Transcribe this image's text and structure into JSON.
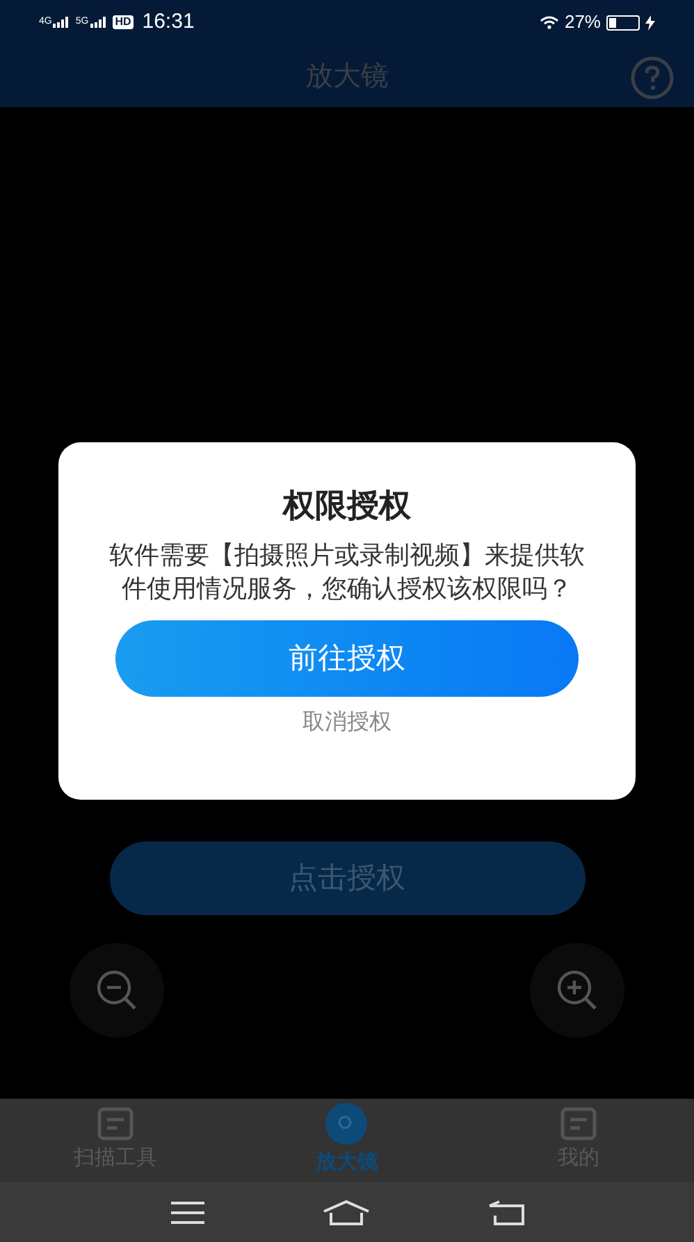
{
  "status_bar": {
    "networks": [
      "4G",
      "5G"
    ],
    "hd": "HD",
    "time": "16:31",
    "battery_text": "27%",
    "battery": {
      "level": 0.27
    }
  },
  "header": {
    "title": "放大镜"
  },
  "main": {
    "authorize_button": "点击授权"
  },
  "dialog": {
    "title": "权限授权",
    "message": "软件需要【拍摄照片或录制视频】来提供软件使用情况服务，您确认授权该权限吗？",
    "confirm": "前往授权",
    "cancel": "取消授权"
  },
  "tabs": [
    {
      "label": "扫描工具",
      "kind": "doc",
      "selected": false
    },
    {
      "label": "放大镜",
      "kind": "lens",
      "selected": true
    },
    {
      "label": "我的",
      "kind": "doc",
      "selected": false
    }
  ]
}
